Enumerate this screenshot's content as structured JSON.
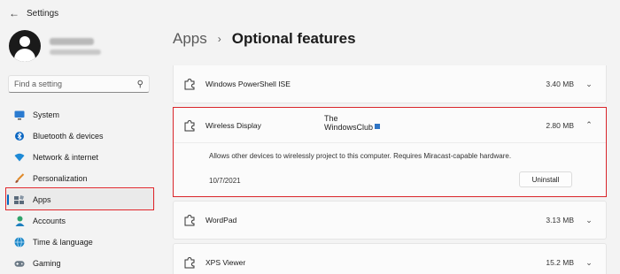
{
  "window": {
    "title": "Settings"
  },
  "search": {
    "placeholder": "Find a setting"
  },
  "nav": {
    "items": [
      {
        "label": "System",
        "icon": "monitor-icon"
      },
      {
        "label": "Bluetooth & devices",
        "icon": "bluetooth-icon"
      },
      {
        "label": "Network & internet",
        "icon": "wifi-icon"
      },
      {
        "label": "Personalization",
        "icon": "brush-icon"
      },
      {
        "label": "Apps",
        "icon": "apps-icon",
        "active": true
      },
      {
        "label": "Accounts",
        "icon": "person-icon"
      },
      {
        "label": "Time & language",
        "icon": "globe-icon"
      },
      {
        "label": "Gaming",
        "icon": "gamepad-icon"
      }
    ]
  },
  "header": {
    "parent": "Apps",
    "current": "Optional features"
  },
  "features": {
    "powershell": {
      "name": "Windows PowerShell ISE",
      "size": "3.40 MB"
    },
    "wireless": {
      "name": "Wireless Display",
      "size": "2.80 MB",
      "description": "Allows other devices to wirelessly project to this computer.  Requires Miracast-capable hardware.",
      "date": "10/7/2021",
      "uninstall_label": "Uninstall"
    },
    "wordpad": {
      "name": "WordPad",
      "size": "3.13 MB"
    },
    "xps": {
      "name": "XPS Viewer",
      "size": "15.2 MB"
    }
  },
  "watermark": {
    "line1": "The",
    "line2": "WindowsClub"
  },
  "colors": {
    "accent": "#0067c0",
    "highlight_border": "#e0262b"
  }
}
